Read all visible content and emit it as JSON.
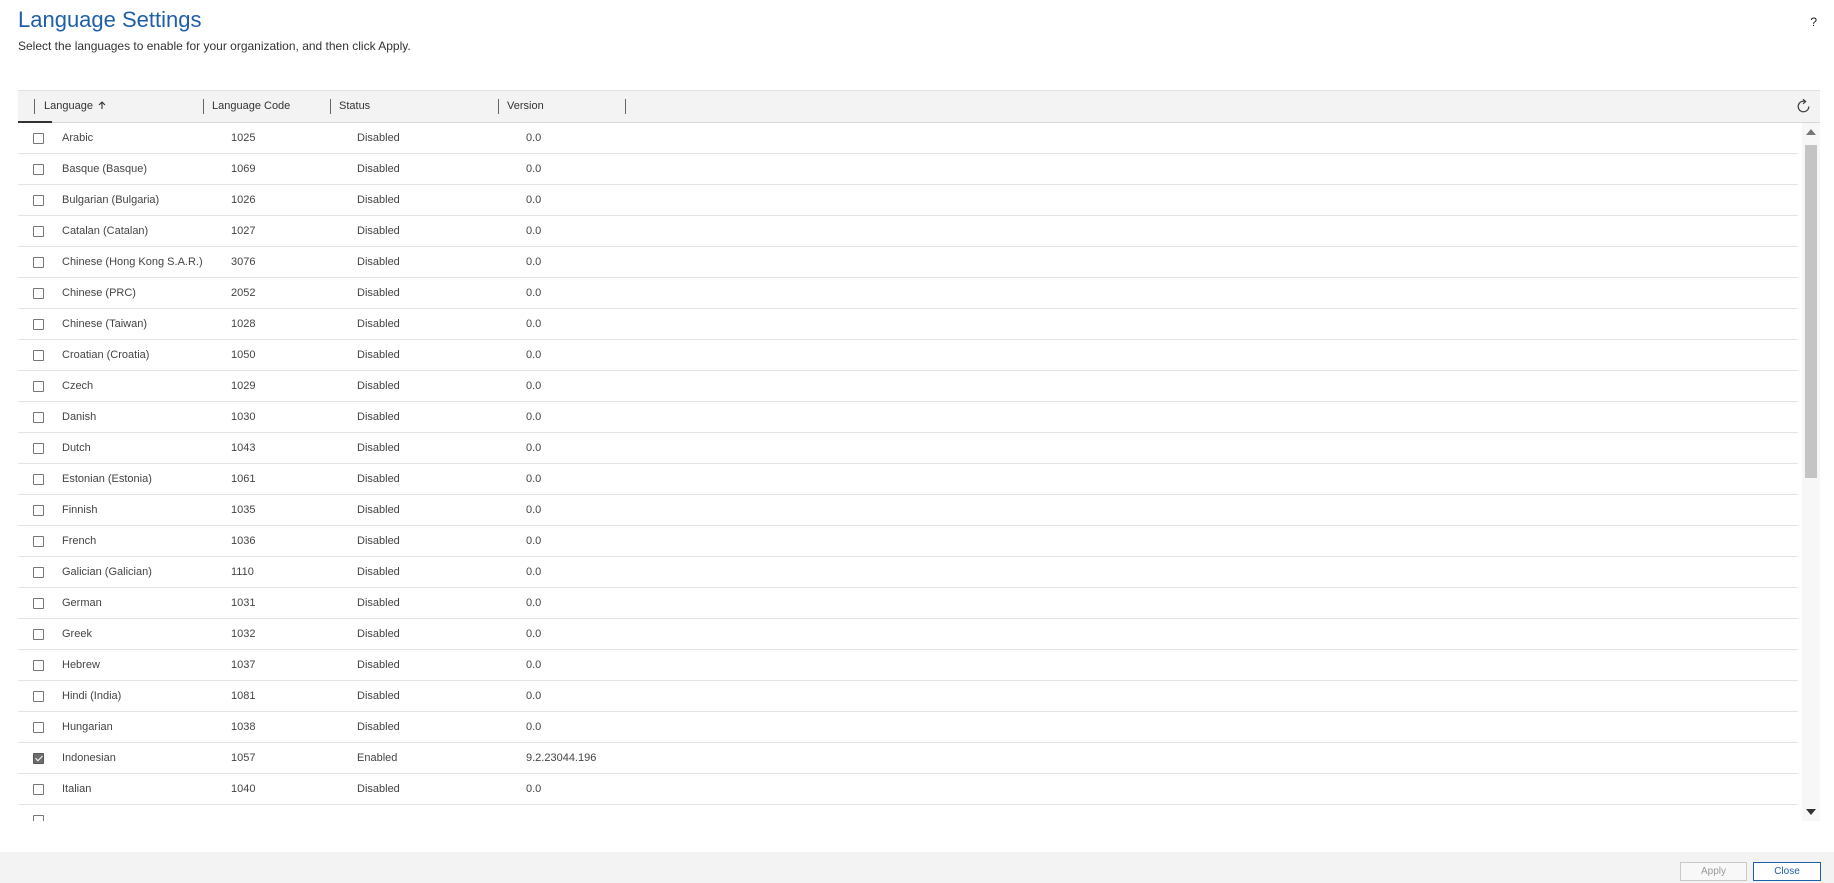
{
  "page": {
    "title": "Language Settings",
    "subtitle": "Select the languages to enable for your organization, and then click Apply.",
    "help_label": "?"
  },
  "grid": {
    "columns": {
      "language": "Language",
      "language_code": "Language Code",
      "status": "Status",
      "version": "Version"
    },
    "sort_icon": "arrow-up-icon",
    "rows": [
      {
        "language": "Arabic",
        "code": "1025",
        "status": "Disabled",
        "version": "0.0",
        "checked": false
      },
      {
        "language": "Basque (Basque)",
        "code": "1069",
        "status": "Disabled",
        "version": "0.0",
        "checked": false
      },
      {
        "language": "Bulgarian (Bulgaria)",
        "code": "1026",
        "status": "Disabled",
        "version": "0.0",
        "checked": false
      },
      {
        "language": "Catalan (Catalan)",
        "code": "1027",
        "status": "Disabled",
        "version": "0.0",
        "checked": false
      },
      {
        "language": "Chinese (Hong Kong S.A.R.)",
        "code": "3076",
        "status": "Disabled",
        "version": "0.0",
        "checked": false
      },
      {
        "language": "Chinese (PRC)",
        "code": "2052",
        "status": "Disabled",
        "version": "0.0",
        "checked": false
      },
      {
        "language": "Chinese (Taiwan)",
        "code": "1028",
        "status": "Disabled",
        "version": "0.0",
        "checked": false
      },
      {
        "language": "Croatian (Croatia)",
        "code": "1050",
        "status": "Disabled",
        "version": "0.0",
        "checked": false
      },
      {
        "language": "Czech",
        "code": "1029",
        "status": "Disabled",
        "version": "0.0",
        "checked": false
      },
      {
        "language": "Danish",
        "code": "1030",
        "status": "Disabled",
        "version": "0.0",
        "checked": false
      },
      {
        "language": "Dutch",
        "code": "1043",
        "status": "Disabled",
        "version": "0.0",
        "checked": false
      },
      {
        "language": "Estonian (Estonia)",
        "code": "1061",
        "status": "Disabled",
        "version": "0.0",
        "checked": false
      },
      {
        "language": "Finnish",
        "code": "1035",
        "status": "Disabled",
        "version": "0.0",
        "checked": false
      },
      {
        "language": "French",
        "code": "1036",
        "status": "Disabled",
        "version": "0.0",
        "checked": false
      },
      {
        "language": "Galician (Galician)",
        "code": "1110",
        "status": "Disabled",
        "version": "0.0",
        "checked": false
      },
      {
        "language": "German",
        "code": "1031",
        "status": "Disabled",
        "version": "0.0",
        "checked": false
      },
      {
        "language": "Greek",
        "code": "1032",
        "status": "Disabled",
        "version": "0.0",
        "checked": false
      },
      {
        "language": "Hebrew",
        "code": "1037",
        "status": "Disabled",
        "version": "0.0",
        "checked": false
      },
      {
        "language": "Hindi (India)",
        "code": "1081",
        "status": "Disabled",
        "version": "0.0",
        "checked": false
      },
      {
        "language": "Hungarian",
        "code": "1038",
        "status": "Disabled",
        "version": "0.0",
        "checked": false
      },
      {
        "language": "Indonesian",
        "code": "1057",
        "status": "Enabled",
        "version": "9.2.23044.196",
        "checked": true
      },
      {
        "language": "Italian",
        "code": "1040",
        "status": "Disabled",
        "version": "0.0",
        "checked": false
      },
      {
        "language": "",
        "code": "",
        "status": "",
        "version": "",
        "checked": false
      }
    ]
  },
  "footer": {
    "apply_label": "Apply",
    "close_label": "Close"
  },
  "colors": {
    "title": "#1f5fa8",
    "close_button": "#1f5fa8"
  }
}
